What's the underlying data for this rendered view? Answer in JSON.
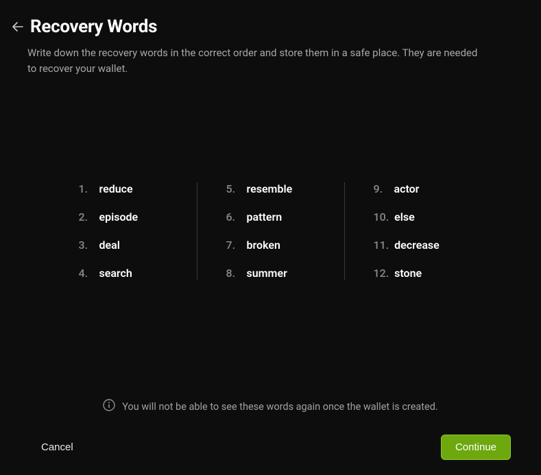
{
  "header": {
    "title": "Recovery Words",
    "subtitle": "Write down the recovery words in the correct order and store them in a safe place. They are needed to recover your wallet."
  },
  "words": [
    {
      "index": "1.",
      "value": "reduce"
    },
    {
      "index": "2.",
      "value": "episode"
    },
    {
      "index": "3.",
      "value": "deal"
    },
    {
      "index": "4.",
      "value": "search"
    },
    {
      "index": "5.",
      "value": "resemble"
    },
    {
      "index": "6.",
      "value": "pattern"
    },
    {
      "index": "7.",
      "value": "broken"
    },
    {
      "index": "8.",
      "value": "summer"
    },
    {
      "index": "9.",
      "value": "actor"
    },
    {
      "index": "10.",
      "value": "else"
    },
    {
      "index": "11.",
      "value": "decrease"
    },
    {
      "index": "12.",
      "value": "stone"
    }
  ],
  "warning": "You will not be able to see these words again once the wallet is created.",
  "footer": {
    "cancel": "Cancel",
    "continue": "Continue"
  }
}
